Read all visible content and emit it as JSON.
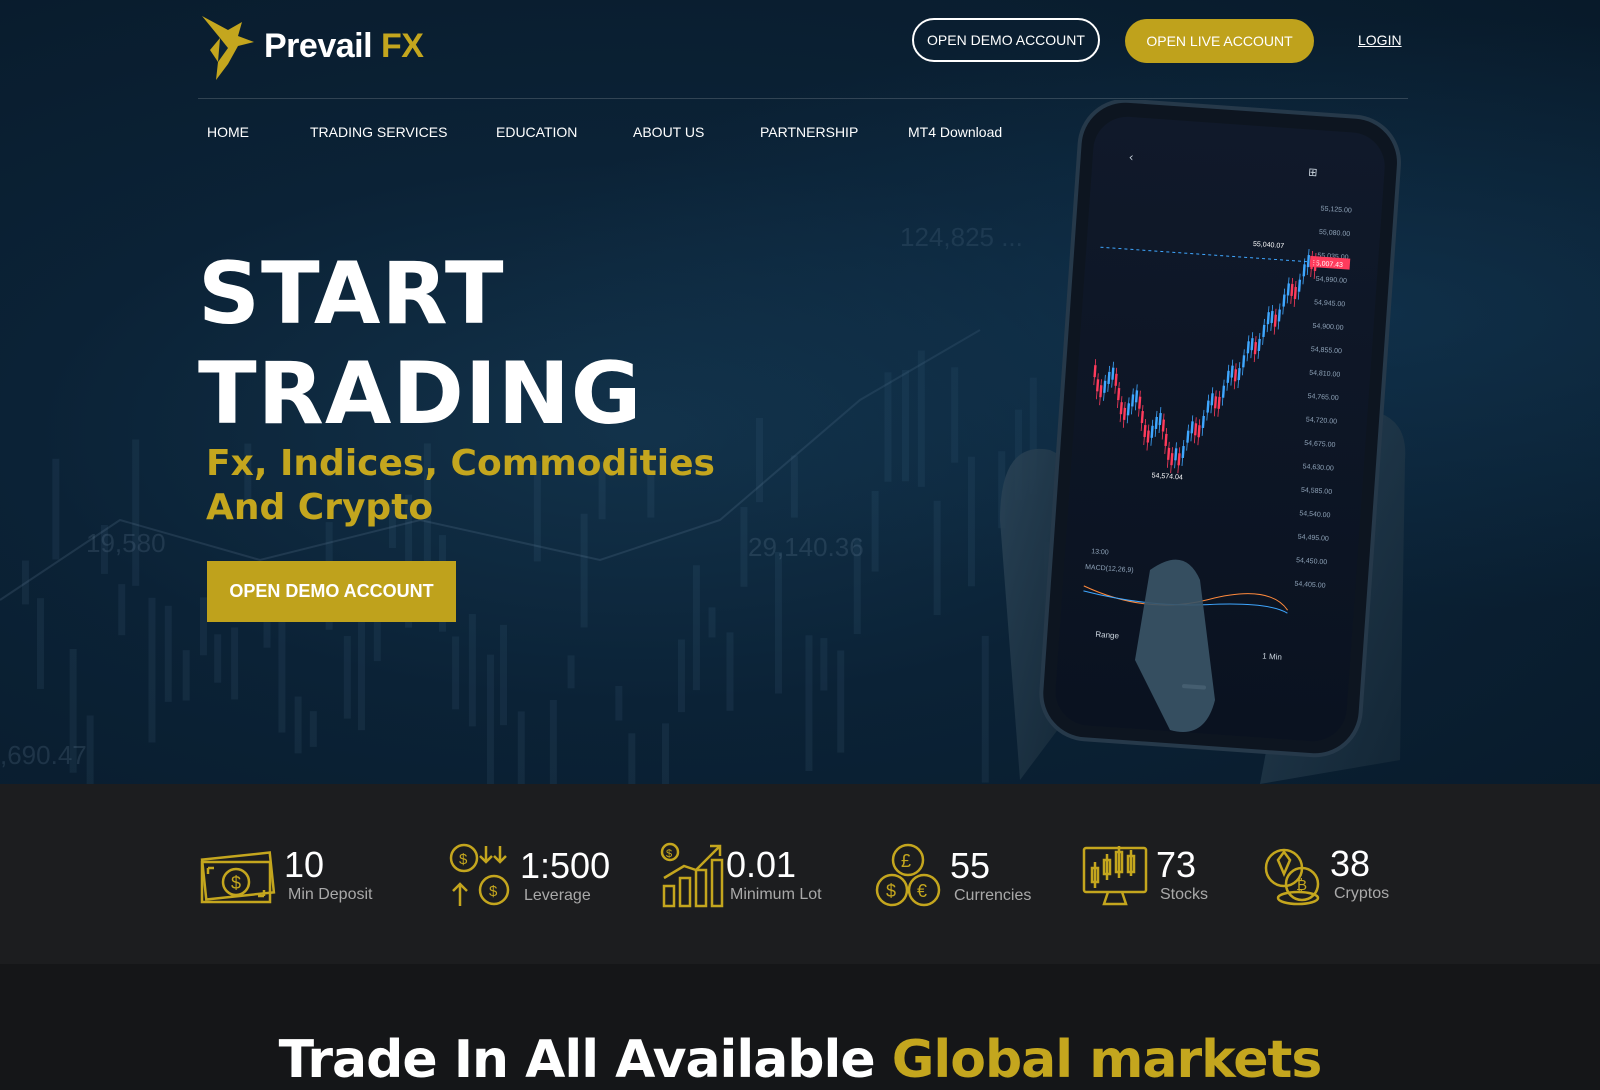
{
  "brand": {
    "name_main": "Prevail",
    "name_accent": "FX"
  },
  "header": {
    "demo_button": "OPEN DEMO ACCOUNT",
    "live_button": "OPEN LIVE ACCOUNT",
    "login": "LOGIN"
  },
  "nav": {
    "items": [
      {
        "label": "HOME"
      },
      {
        "label": "TRADING SERVICES"
      },
      {
        "label": "EDUCATION"
      },
      {
        "label": "ABOUT US"
      },
      {
        "label": "PARTNERSHIP"
      },
      {
        "label": "MT4 Download"
      }
    ]
  },
  "hero": {
    "title_line1": "START",
    "title_line2": "TRADING",
    "subtitle_line1": "Fx, Indices, Commodities",
    "subtitle_line2": "And Crypto",
    "cta": "OPEN DEMO ACCOUNT",
    "background_tickers": [
      "124,825 ...",
      "19,580",
      "29,140.36",
      ",690.47"
    ]
  },
  "phone": {
    "price_levels": [
      "55,125.00",
      "55,080.00",
      "55,035.00",
      "54,990.00",
      "54,945.00",
      "54,900.00",
      "54,855.00",
      "54,810.00",
      "54,765.00",
      "54,720.00",
      "54,675.00",
      "54,630.00",
      "54,585.00",
      "54,540.00",
      "54,495.00",
      "54,450.00",
      "54,405.00"
    ],
    "high_label": "55,040.07",
    "current_price": "55,007.43",
    "low_label": "54,574.04",
    "indicator_label": "MACD(12,26,9)",
    "time_label": "13:00",
    "range_label": "Range",
    "interval_label": "1 Min"
  },
  "stats": [
    {
      "value": "10",
      "label": "Min Deposit",
      "icon": "cash-icon"
    },
    {
      "value": "1:500",
      "label": "Leverage",
      "icon": "leverage-coins-icon"
    },
    {
      "value": "0.01",
      "label": "Minimum Lot",
      "icon": "growth-chart-icon"
    },
    {
      "value": "55",
      "label": "Currencies",
      "icon": "currency-coins-icon"
    },
    {
      "value": "73",
      "label": "Stocks",
      "icon": "stock-monitor-icon"
    },
    {
      "value": "38",
      "label": "Cryptos",
      "icon": "crypto-coins-icon"
    }
  ],
  "section": {
    "title_white": "Trade In All Available",
    "title_gold": "Global markets"
  },
  "colors": {
    "gold": "#c4a61e",
    "hero_bg": "#0b2236",
    "stats_bg": "#1c1d1f",
    "up_candle": "#3fa7ff",
    "down_candle": "#ff3b5c"
  }
}
